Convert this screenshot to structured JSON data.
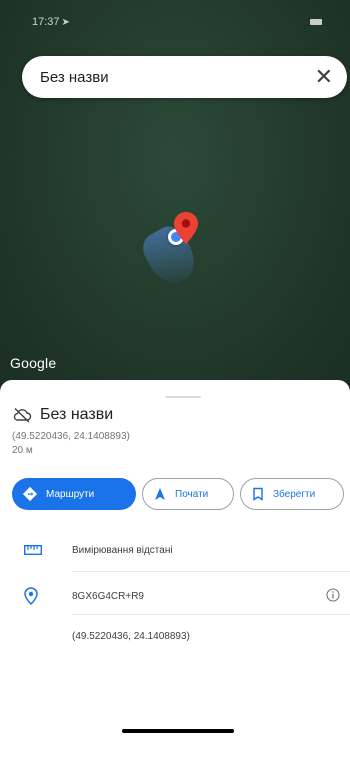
{
  "status_bar": {
    "time": "17:37",
    "location_arrow": "location-arrow-icon"
  },
  "search": {
    "title": "Без назви",
    "close_icon": "close-icon",
    "close_glyph": "✕"
  },
  "map": {
    "attribution": "Google",
    "colors": {
      "background": "#22392b",
      "pin": "#ea4335",
      "location_dot": "#4285f4"
    }
  },
  "place": {
    "title": "Без назви",
    "coordinates": "(49.5220436, 24.1408893)",
    "distance": "20 м"
  },
  "actions": {
    "directions_label": "Маршрути",
    "start_label": "Почати",
    "save_label": "Зберегти"
  },
  "details": {
    "measure_distance": "Вимірювання відстані",
    "plus_code": "8GX6G4CR+R9",
    "coordinates": "(49.5220436, 24.1408893)"
  },
  "colors": {
    "accent": "#1a73e8",
    "text": "#202124",
    "secondary_text": "#70757a"
  }
}
